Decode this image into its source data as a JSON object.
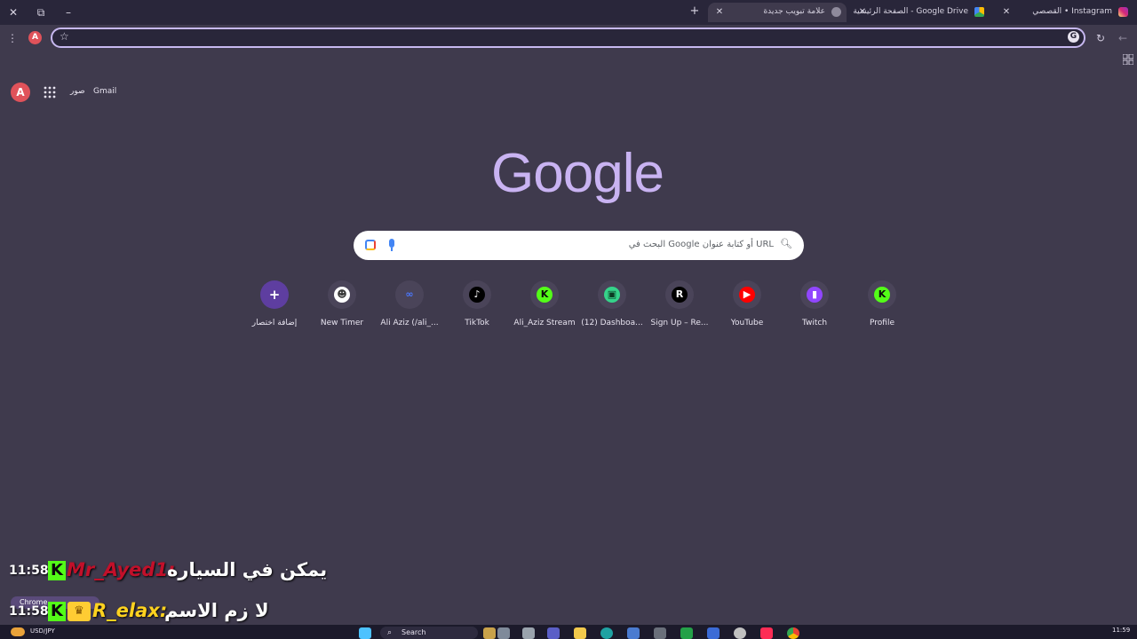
{
  "tabs": [
    {
      "title": "علامة تبويب جديدة",
      "active": true
    },
    {
      "title": "الصفحة الرئيسية - Google Drive",
      "active": false
    },
    {
      "title": "القصصي • Instagram",
      "active": false
    }
  ],
  "toolbar": {
    "url_value": "",
    "profile_letter": "A",
    "search_engine_letter": "G"
  },
  "ntp": {
    "avatar_letter": "A",
    "gmail_label": "Gmail",
    "images_label": "صور",
    "logo_text": "Google",
    "search_placeholder": "البحث في Google أو كتابة عنوان URL",
    "shortcuts": [
      {
        "label": "إضافة اختصار",
        "glyph": "+",
        "color": "#ffffff",
        "bg": "#5e3ea0"
      },
      {
        "label": "New Timer",
        "glyph": "☻",
        "color": "#3a3a3a",
        "bg": "#ffffff"
      },
      {
        "label": "Ali Aziz (/ali_...",
        "glyph": "∞",
        "color": "#4a78ff",
        "bg": "#4a4459"
      },
      {
        "label": "TikTok",
        "glyph": "♪",
        "color": "#ffffff",
        "bg": "#000000"
      },
      {
        "label": "Ali_Aziz Stream",
        "glyph": "K",
        "color": "#0b0b0b",
        "bg": "#53fc18"
      },
      {
        "label": "(12) Dashboa...",
        "glyph": "▣",
        "color": "#0b3a22",
        "bg": "#35d38a"
      },
      {
        "label": "Sign Up – Re...",
        "glyph": "R",
        "color": "#ffffff",
        "bg": "#000000"
      },
      {
        "label": "YouTube",
        "glyph": "▶",
        "color": "#ffffff",
        "bg": "#ff0000"
      },
      {
        "label": "Twitch",
        "glyph": "▮",
        "color": "#ffffff",
        "bg": "#9146ff"
      },
      {
        "label": "Profile",
        "glyph": "K",
        "color": "#0b0b0b",
        "bg": "#53fc18"
      }
    ]
  },
  "chat": [
    {
      "time": "11:58",
      "user": "Mr_Ayed1:",
      "user_color": "#c2102a",
      "message": "يمكن في السياره",
      "crown": false
    },
    {
      "time": "11:58",
      "user": "R_elax:",
      "user_color": "#ffd21f",
      "message": "لا زم الاسم",
      "crown": true
    }
  ],
  "chrome_pill": "Chrome",
  "taskbar": {
    "search_label": "Search",
    "ticker_label": "USD/JPY",
    "clock": "11:59"
  }
}
